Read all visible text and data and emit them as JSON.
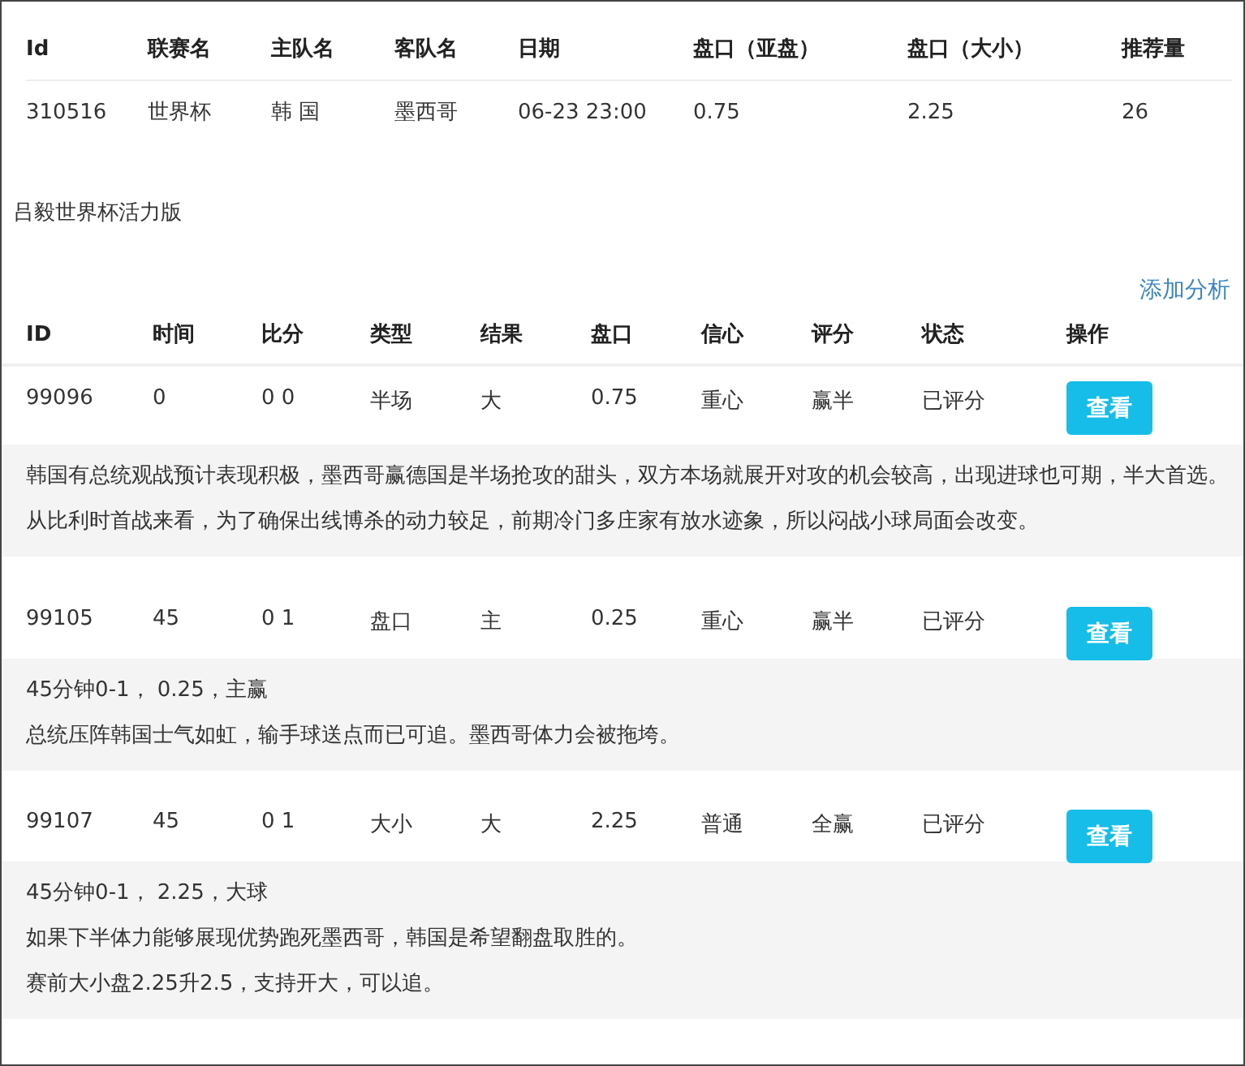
{
  "match_table": {
    "columns": [
      "Id",
      "联赛名",
      "主队名",
      "客队名",
      "日期",
      "盘口（亚盘）",
      "盘口（大小）",
      "推荐量"
    ],
    "rows": [
      [
        "310516",
        "世界杯",
        "韩 国",
        "墨西哥",
        "06-23 23:00",
        "0.75",
        "2.25",
        "26"
      ]
    ]
  },
  "title": "吕毅世界杯活力版",
  "add_link": "添加分析",
  "analysis_table": {
    "columns": [
      "ID",
      "时间",
      "比分",
      "类型",
      "结果",
      "盘口",
      "信心",
      "评分",
      "状态",
      "操作"
    ],
    "rows": [
      {
        "cells": [
          "99096",
          "0",
          "0 0",
          "半场",
          "大",
          "0.75",
          "重心",
          "赢半",
          "已评分"
        ],
        "button": "查看",
        "notes": [
          "韩国有总统观战预计表现积极，墨西哥赢德国是半场抢攻的甜头，双方本场就展开对攻的机会较高，出现进球也可期，半大首选。",
          "从比利时首战来看，为了确保出线博杀的动力较足，前期冷门多庄家有放水迹象，所以闷战小球局面会改变。"
        ]
      },
      {
        "cells": [
          "99105",
          "45",
          "0 1",
          "盘口",
          "主",
          "0.25",
          "重心",
          "赢半",
          "已评分"
        ],
        "button": "查看",
        "notes": [
          "45分钟0-1， 0.25，主赢",
          "总统压阵韩国士气如虹，输手球送点而已可追。墨西哥体力会被拖垮。"
        ]
      },
      {
        "cells": [
          "99107",
          "45",
          "0 1",
          "大小",
          "大",
          "2.25",
          "普通",
          "全赢",
          "已评分"
        ],
        "button": "查看",
        "notes": [
          "45分钟0-1， 2.25，大球",
          "如果下半体力能够展现优势跑死墨西哥，韩国是希望翻盘取胜的。",
          "赛前大小盘2.25升2.5，支持开大，可以追。"
        ]
      }
    ]
  }
}
